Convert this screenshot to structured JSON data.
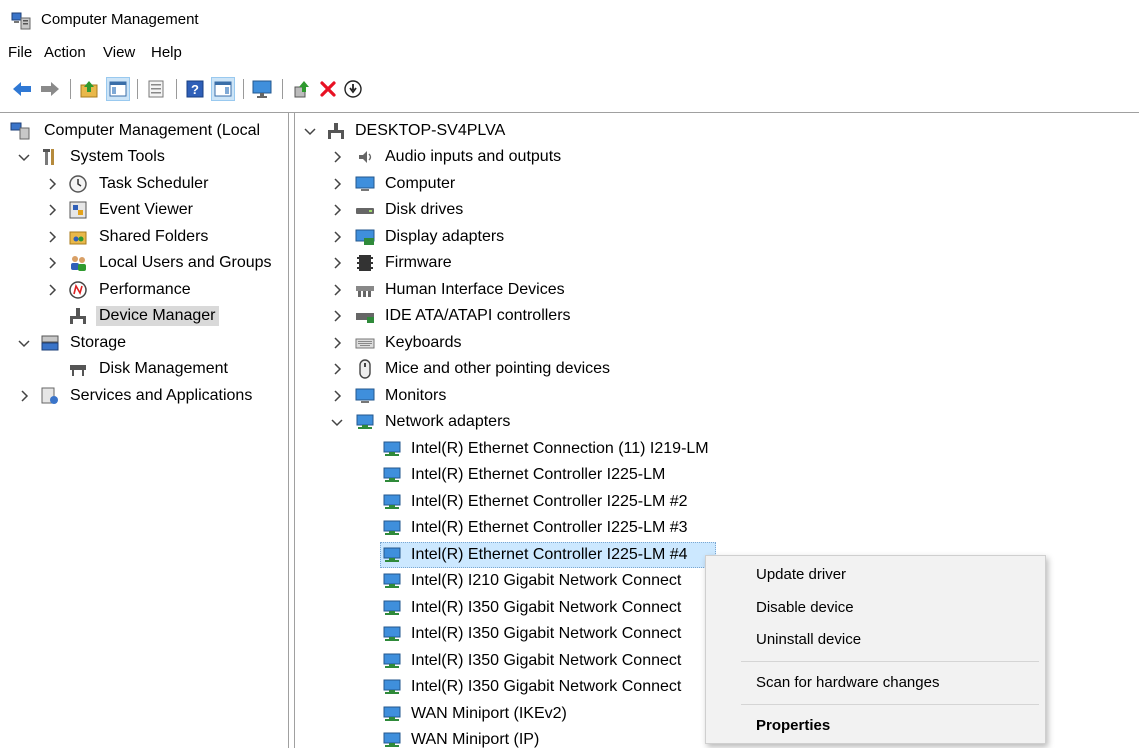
{
  "window": {
    "title": "Computer Management"
  },
  "menu": [
    "File",
    "Action",
    "View",
    "Help"
  ],
  "toolbar": {
    "buttons": [
      "back-arrow-icon",
      "forward-arrow-icon",
      "up-folder-icon",
      "show-hide-tree-icon",
      "properties-sheet-icon",
      "help-icon",
      "show-action-pane-icon",
      "monitor-icon",
      "update-driver-icon",
      "uninstall-icon",
      "disable-device-icon"
    ]
  },
  "left_tree": {
    "root": "Computer Management (Local",
    "items": [
      {
        "label": "System Tools"
      },
      {
        "label": "Task Scheduler"
      },
      {
        "label": "Event Viewer"
      },
      {
        "label": "Shared Folders"
      },
      {
        "label": "Local Users and Groups"
      },
      {
        "label": "Performance"
      },
      {
        "label": "Device Manager"
      },
      {
        "label": "Storage"
      },
      {
        "label": "Disk Management"
      },
      {
        "label": "Services and Applications"
      }
    ]
  },
  "device_tree": {
    "root": "DESKTOP-SV4PLVA",
    "categories": [
      "Audio inputs and outputs",
      "Computer",
      "Disk drives",
      "Display adapters",
      "Firmware",
      "Human Interface Devices",
      "IDE ATA/ATAPI controllers",
      "Keyboards",
      "Mice and other pointing devices",
      "Monitors",
      "Network adapters"
    ],
    "network_adapters": [
      "Intel(R) Ethernet Connection (11) I219-LM",
      "Intel(R) Ethernet Controller I225-LM",
      "Intel(R) Ethernet Controller I225-LM #2",
      "Intel(R) Ethernet Controller I225-LM #3",
      "Intel(R) Ethernet Controller I225-LM #4",
      "Intel(R) I210 Gigabit Network Connect",
      "Intel(R) I350 Gigabit Network Connect",
      "Intel(R) I350 Gigabit Network Connect",
      "Intel(R) I350 Gigabit Network Connect",
      "Intel(R) I350 Gigabit Network Connect",
      "WAN Miniport (IKEv2)",
      "WAN Miniport (IP)"
    ]
  },
  "context_menu": {
    "items": [
      "Update driver",
      "Disable device",
      "Uninstall device",
      "Scan for hardware changes",
      "Properties"
    ]
  },
  "colors": {
    "selection_blue": "#cce8ff",
    "selection_gray": "#d9d9d9",
    "menu_bg": "#f2f2f2",
    "delete_red": "#e81123"
  }
}
